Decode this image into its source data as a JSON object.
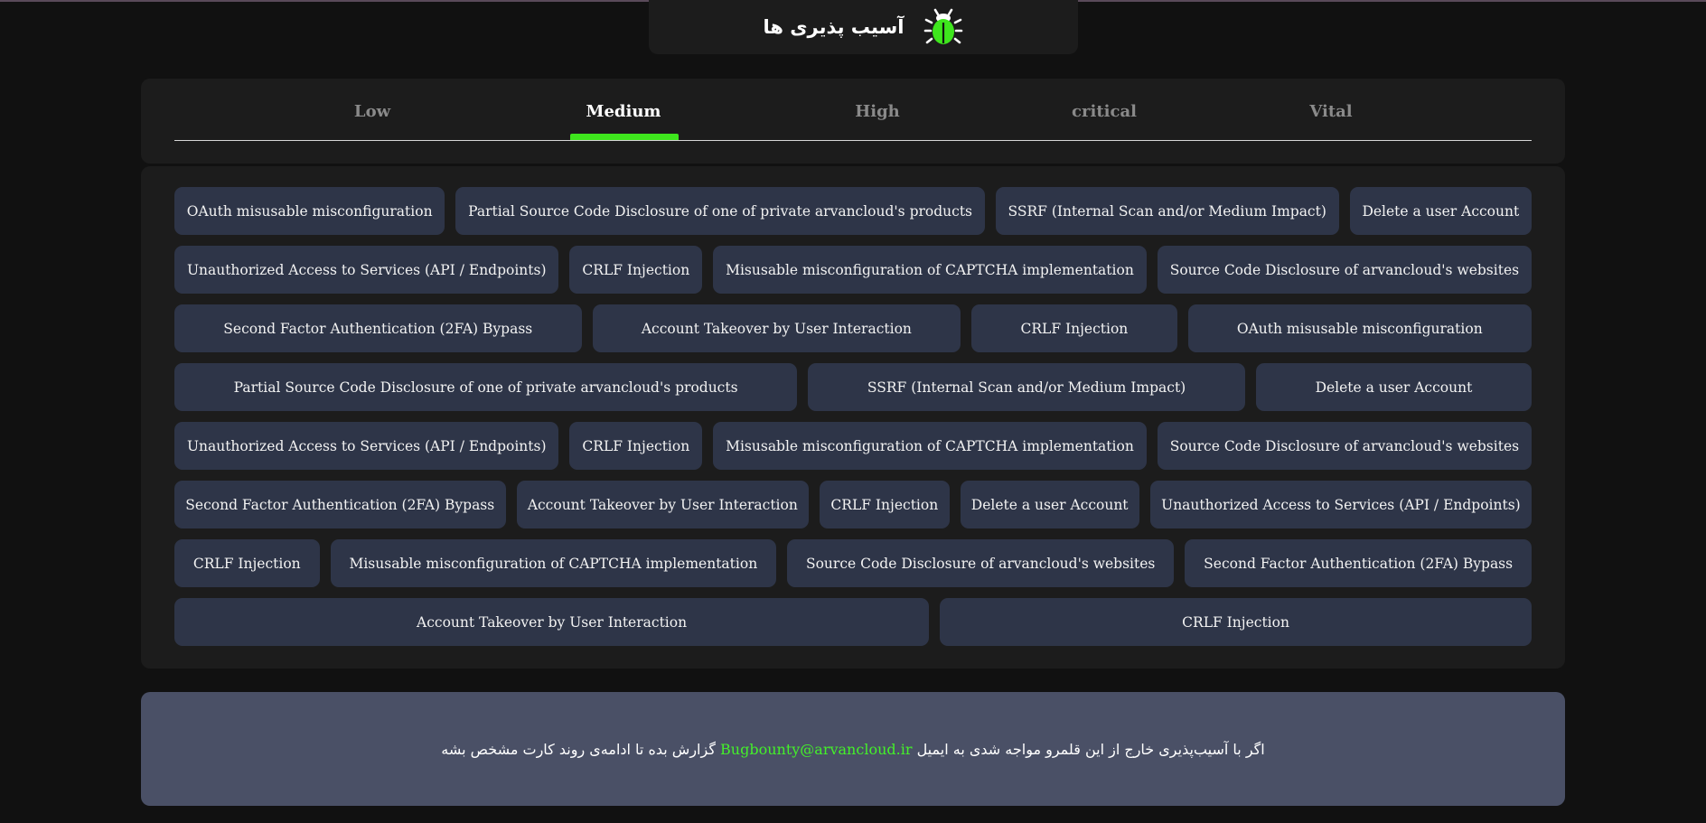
{
  "header": {
    "title": "آسیب پذیری ها",
    "icon": "bug-icon",
    "icon_color": "#3ee61d"
  },
  "tabs": [
    {
      "label": "Low",
      "active": false
    },
    {
      "label": "Medium",
      "active": true
    },
    {
      "label": "High",
      "active": false
    },
    {
      "label": "critical",
      "active": false
    },
    {
      "label": "Vital",
      "active": false
    }
  ],
  "accent_color": "#3ee61d",
  "vulnerabilities": [
    "OAuth misusable misconfiguration",
    "Partial Source Code Disclosure of one of private arvancloud's products",
    "SSRF (Internal Scan and/or Medium Impact)",
    "Delete a user Account",
    "Unauthorized Access to Services (API / Endpoints)",
    "CRLF Injection",
    "Misusable misconfiguration of CAPTCHA implementation",
    "Source Code Disclosure of arvancloud's websites",
    "Second Factor Authentication (2FA) Bypass",
    "Account Takeover by User Interaction",
    "CRLF Injection",
    "OAuth misusable misconfiguration",
    "Partial Source Code Disclosure of one of private arvancloud's products",
    "SSRF (Internal Scan and/or Medium Impact)",
    "Delete a user Account",
    "Unauthorized Access to Services (API / Endpoints)",
    "CRLF Injection",
    "Misusable misconfiguration of CAPTCHA implementation",
    "Source Code Disclosure of arvancloud's websites",
    "Second Factor Authentication (2FA) Bypass",
    "Account Takeover by User Interaction",
    "CRLF Injection",
    "Delete a user Account",
    "Unauthorized Access to Services (API / Endpoints)",
    "CRLF Injection",
    "Misusable misconfiguration of CAPTCHA implementation",
    "Source Code Disclosure of arvancloud's websites",
    "Second Factor Authentication (2FA) Bypass",
    "Account Takeover by User Interaction",
    "CRLF Injection"
  ],
  "footer": {
    "text_before": "اگر با آسیب‌پذیری خارج از این قلمرو مواجه شدی به ایمیل",
    "email": "Bugbounty@arvancloud.ir",
    "text_after": "گزارش بده تا ادامه‌ی روند کارت مشخص بشه"
  }
}
